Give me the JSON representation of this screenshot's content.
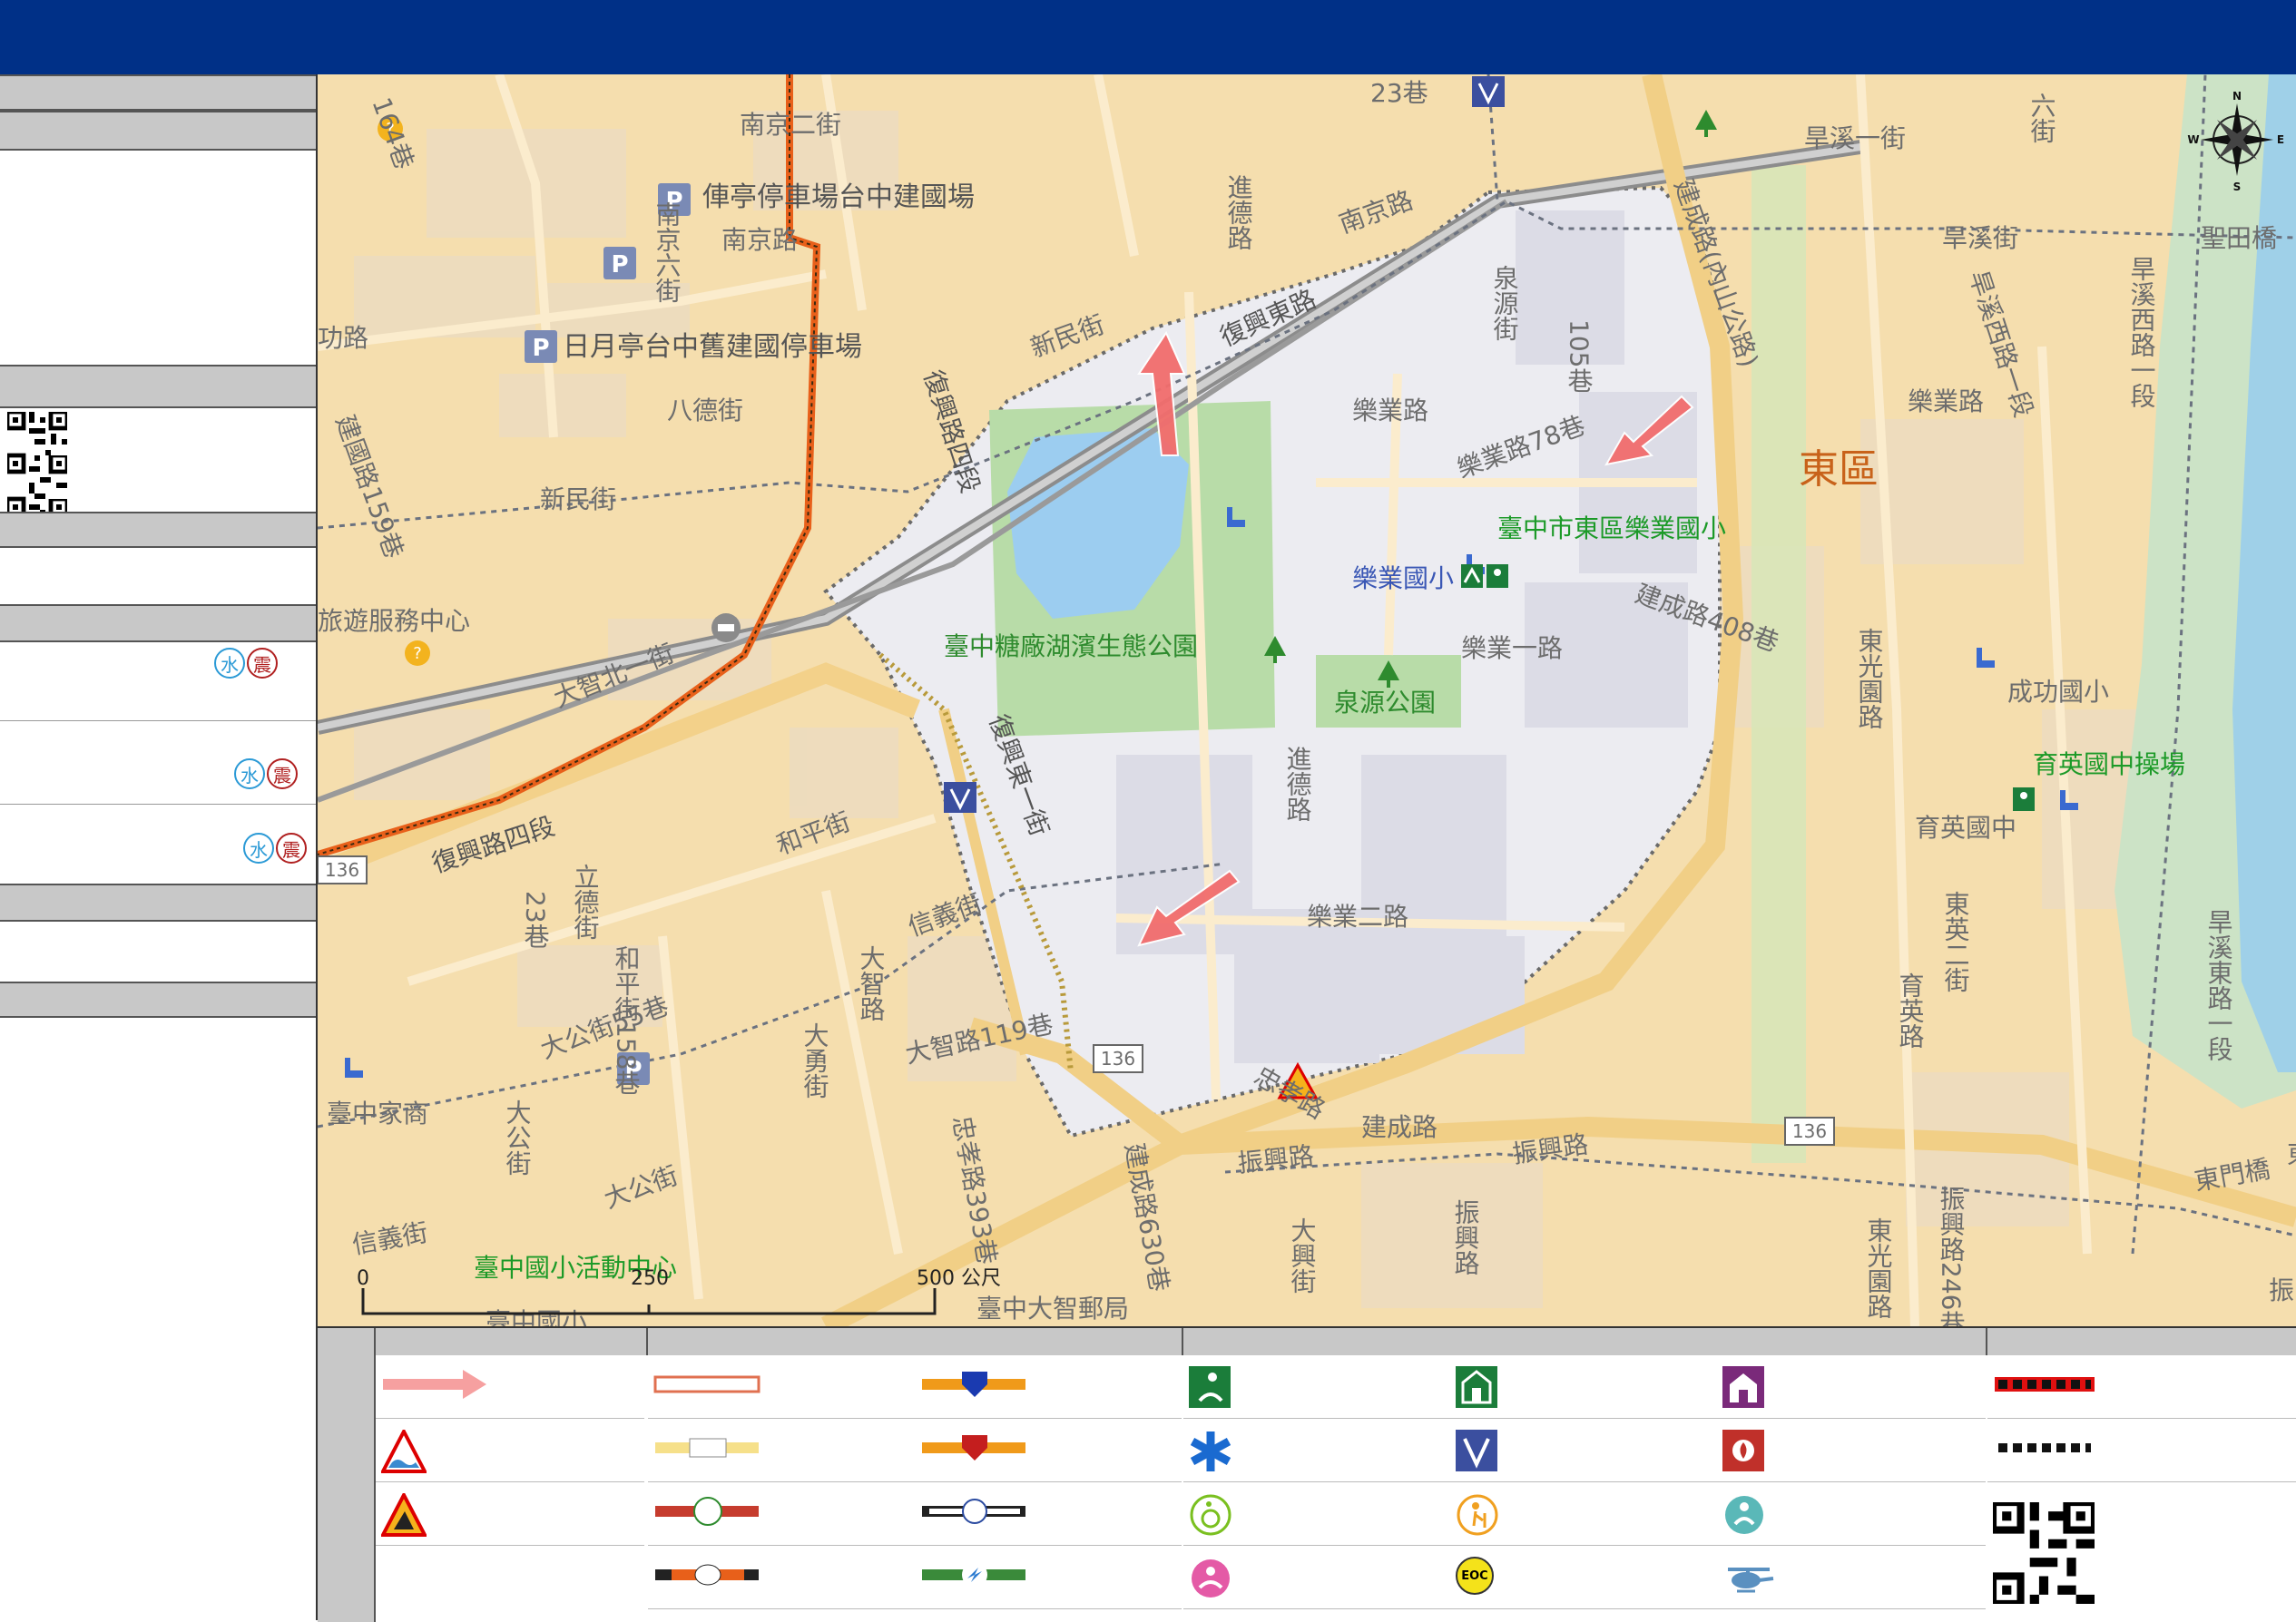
{
  "map": {
    "labels": {
      "nanjing_er": "南京二街",
      "nanjing_liu": "南京六街",
      "nanjing_road": "南京路",
      "nanjing_road_ne": "南京路",
      "parking_1": "俥亭停車場台中建國場",
      "parking_2": "日月亭台中舊建國停車場",
      "bade": "八德街",
      "xinmin_1": "新民街",
      "xinmin_2": "新民街",
      "fuxing_east": "復興東路",
      "fuxing_east_1": "復興東一街",
      "fuxing_4": "復興路四段",
      "fuxing_4_v": "復興路四段",
      "dazhi_north": "大智北一街",
      "travel_center": "旅遊服務中心",
      "lane_23": "23巷",
      "jinde_1": "進德路",
      "jinde_2": "進德路",
      "quanyuan": "泉源街",
      "lane_105": "105巷",
      "yueye": "樂業路",
      "yueye_78": "樂業路78巷",
      "yueye_1": "樂業一路",
      "yueye_2": "樂業二路",
      "school_green": "臺中市東區樂業國小",
      "school_blue": "樂業國小",
      "park_lake": "臺中糖廠湖濱生態公園",
      "quanyuan_park": "泉源公園",
      "jiancheng_408": "建成路408巷",
      "jiancheng_main": "建成路(內山公路)",
      "east_district": "東區",
      "chenggong": "成功國小",
      "yuying_field": "育英國中操場",
      "yuying": "育英國中",
      "hanxi_1": "旱溪一街",
      "hanxi_2": "旱溪街",
      "hanxi_west": "旱溪西路一段",
      "hanxi_east": "旱溪東路一段",
      "hanxi_west_19": "旱溪西路一段",
      "dongguang": "東光園路",
      "dongguang_2": "東光園路",
      "dongying": "東英二街",
      "yuying_rd": "育英路",
      "zhenxing": "振興路",
      "zhenxing_2": "振興路",
      "zhenxing_246": "振興路246巷",
      "zhenxing_sm": "振興路",
      "zhongxiao": "忠孝路",
      "zhongxiao_393": "忠孝路393巷",
      "jiancheng_630": "建成路630巷",
      "dazhi": "大智路",
      "dazhi_119": "大智路119巷",
      "dayong": "大勇街",
      "dagong": "大公街",
      "dagong_55": "大公街55巷",
      "dagong_2": "大公街",
      "heping": "和平街",
      "heping_158": "和平街158巷",
      "lide": "立德街",
      "lide_23": "23巷",
      "xinyi": "信義街",
      "xinyi_2": "信義街",
      "daxing": "大興街",
      "rt136_a": "136",
      "rt136_b": "136",
      "rt136_c": "136",
      "home_ec": "臺中家商",
      "activity_center": "臺中國小活動中心",
      "post_office": "臺中大智郵局",
      "tc_elem": "臺中國小",
      "lane_164": "164巷",
      "jianguo_159": "建國路159巷",
      "donghe": "東門橋",
      "dongxue": "東學街",
      "shenghe": "聖田橋",
      "liuxiang": "六街",
      "jiancheng_r": "建成路",
      "yueye_rd2": "樂業路",
      "gonglu": "功路",
      "zhen_edge": "振"
    },
    "compass": {
      "n": "N",
      "s": "S",
      "e": "E",
      "w": "W"
    },
    "scale": {
      "t0": "0",
      "t1": "250",
      "t2": "500 公尺"
    }
  },
  "sidebar": {
    "hazards": [
      {
        "water": "水",
        "quake": "震"
      },
      {
        "water": "水",
        "quake": "震"
      },
      {
        "water": "水",
        "quake": "震"
      }
    ]
  },
  "legend": {
    "eoc": "EOC"
  },
  "colors": {
    "header": "#003087",
    "map_base": "#f6e0b0",
    "urban_block": "#e8dcc8",
    "evac_area": "#ededf2",
    "green": "#2e8b2e",
    "route_orange": "#e8601a",
    "arrow": "#f07070"
  }
}
